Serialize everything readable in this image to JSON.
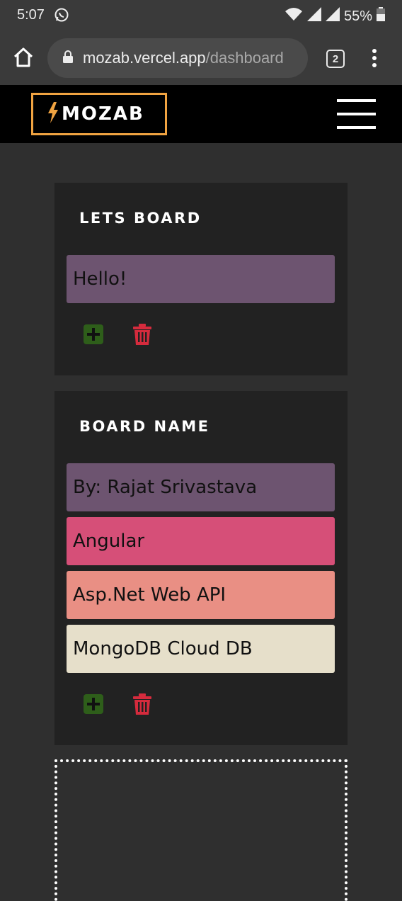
{
  "status_bar": {
    "time": "5:07",
    "battery": "55%",
    "icons": [
      "whatsapp-icon",
      "wifi-icon",
      "signal-icon",
      "signal-icon",
      "battery-icon"
    ]
  },
  "browser": {
    "url_host": "mozab.vercel.app",
    "url_path": "/dashboard",
    "tab_count": "2",
    "icons": [
      "home-icon",
      "lock-icon",
      "tabs-icon",
      "more-icon"
    ]
  },
  "app": {
    "logo_text": "MOZAB",
    "logo_color": "#f0a341",
    "icons": [
      "bolt-icon",
      "hamburger-icon"
    ]
  },
  "boards": [
    {
      "title": "LETS BOARD",
      "cards": [
        {
          "text": "Hello!",
          "color": "#6d5470"
        }
      ]
    },
    {
      "title": "BOARD NAME",
      "cards": [
        {
          "text": "By: Rajat Srivastava",
          "color": "#6d5470"
        },
        {
          "text": "Angular",
          "color": "#d64f78"
        },
        {
          "text": "Asp.Net Web API",
          "color": "#e98f84"
        },
        {
          "text": "MongoDB Cloud DB",
          "color": "#e6dfca"
        }
      ]
    }
  ],
  "actions": {
    "add_icon": "plus-square-icon",
    "add_color": "#2e5e1a",
    "delete_icon": "trash-icon",
    "delete_color": "#d52b3d"
  }
}
